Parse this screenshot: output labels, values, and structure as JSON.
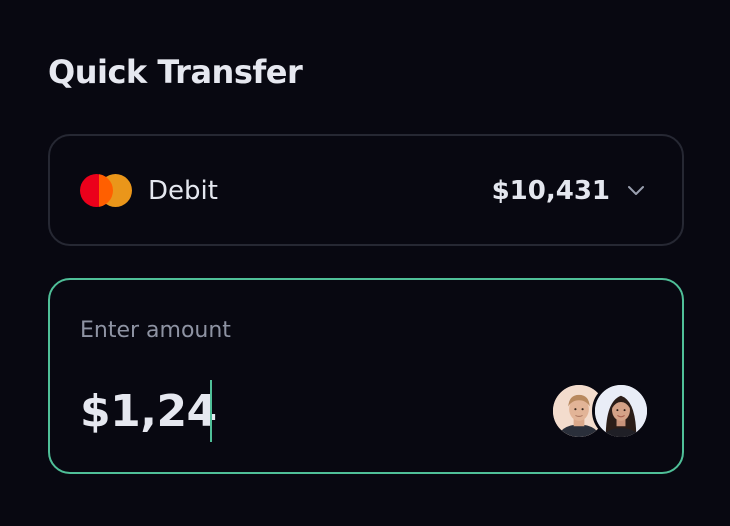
{
  "header": {
    "title": "Quick Transfer"
  },
  "card_selector": {
    "card_brand_icon": "mastercard-logo",
    "card_type": "Debit",
    "balance": "$10,431",
    "dropdown_icon": "chevron-down-icon"
  },
  "amount_input": {
    "label": "Enter amount",
    "value": "$1,24",
    "accent_color": "#4fbf98"
  },
  "recipients": [
    {
      "name": "recipient-avatar-man"
    },
    {
      "name": "recipient-avatar-woman"
    }
  ],
  "colors": {
    "background": "#080811",
    "border": "#262833",
    "accent": "#4fbf98",
    "mastercard_red": "#eb001b",
    "mastercard_orange": "#f79e1b"
  }
}
